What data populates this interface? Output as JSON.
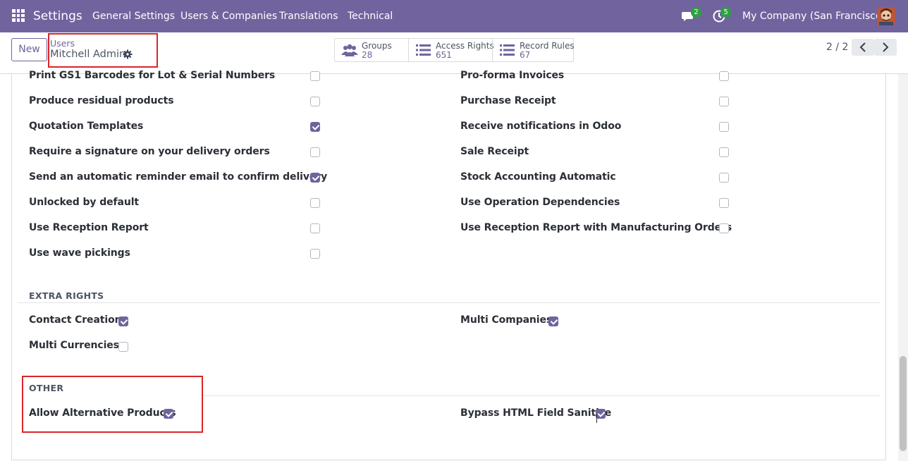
{
  "navbar": {
    "app_name": "Settings",
    "menu": [
      "General Settings",
      "Users & Companies",
      "Translations",
      "Technical"
    ],
    "messages_count": "2",
    "activities_count": "5",
    "company": "My Company (San Francisco)",
    "color": "#71639e"
  },
  "control_panel": {
    "new_label": "New",
    "breadcrumb_parent": "Users",
    "breadcrumb_current": "Mitchell Admin",
    "smart_buttons": [
      {
        "label": "Groups",
        "count": "28",
        "icon": "users-icon"
      },
      {
        "label": "Access Rights",
        "count": "651",
        "icon": "list-icon"
      },
      {
        "label": "Record Rules",
        "count": "67",
        "icon": "list-icon"
      }
    ],
    "pager": "2 / 2"
  },
  "technical_rows": {
    "left": [
      {
        "label": "Print GS1 Barcodes for Lot & Serial Numbers",
        "checked": false
      },
      {
        "label": "Produce residual products",
        "checked": false
      },
      {
        "label": "Quotation Templates",
        "checked": true
      },
      {
        "label": "Require a signature on your delivery orders",
        "checked": false
      },
      {
        "label": "Send an automatic reminder email to confirm delivery",
        "checked": true
      },
      {
        "label": "Unlocked by default",
        "checked": false
      },
      {
        "label": "Use Reception Report",
        "checked": false
      },
      {
        "label": "Use wave pickings",
        "checked": false
      }
    ],
    "right": [
      {
        "label": "Pro-forma Invoices",
        "checked": false
      },
      {
        "label": "Purchase Receipt",
        "checked": false
      },
      {
        "label": "Receive notifications in Odoo",
        "checked": false
      },
      {
        "label": "Sale Receipt",
        "checked": false
      },
      {
        "label": "Stock Accounting Automatic",
        "checked": false
      },
      {
        "label": "Use Operation Dependencies",
        "checked": false
      },
      {
        "label": "Use Reception Report with Manufacturing Orders",
        "checked": false
      }
    ]
  },
  "extra_rights": {
    "title": "EXTRA RIGHTS",
    "items": [
      {
        "label": "Contact Creation",
        "checked": true
      },
      {
        "label": "Multi Companies",
        "checked": true
      },
      {
        "label": "Multi Currencies",
        "checked": false
      }
    ]
  },
  "other": {
    "title": "OTHER",
    "items": [
      {
        "label": "Allow Alternative Products",
        "checked": true
      },
      {
        "label": "Bypass HTML Field Sanitize",
        "checked": true
      }
    ]
  }
}
